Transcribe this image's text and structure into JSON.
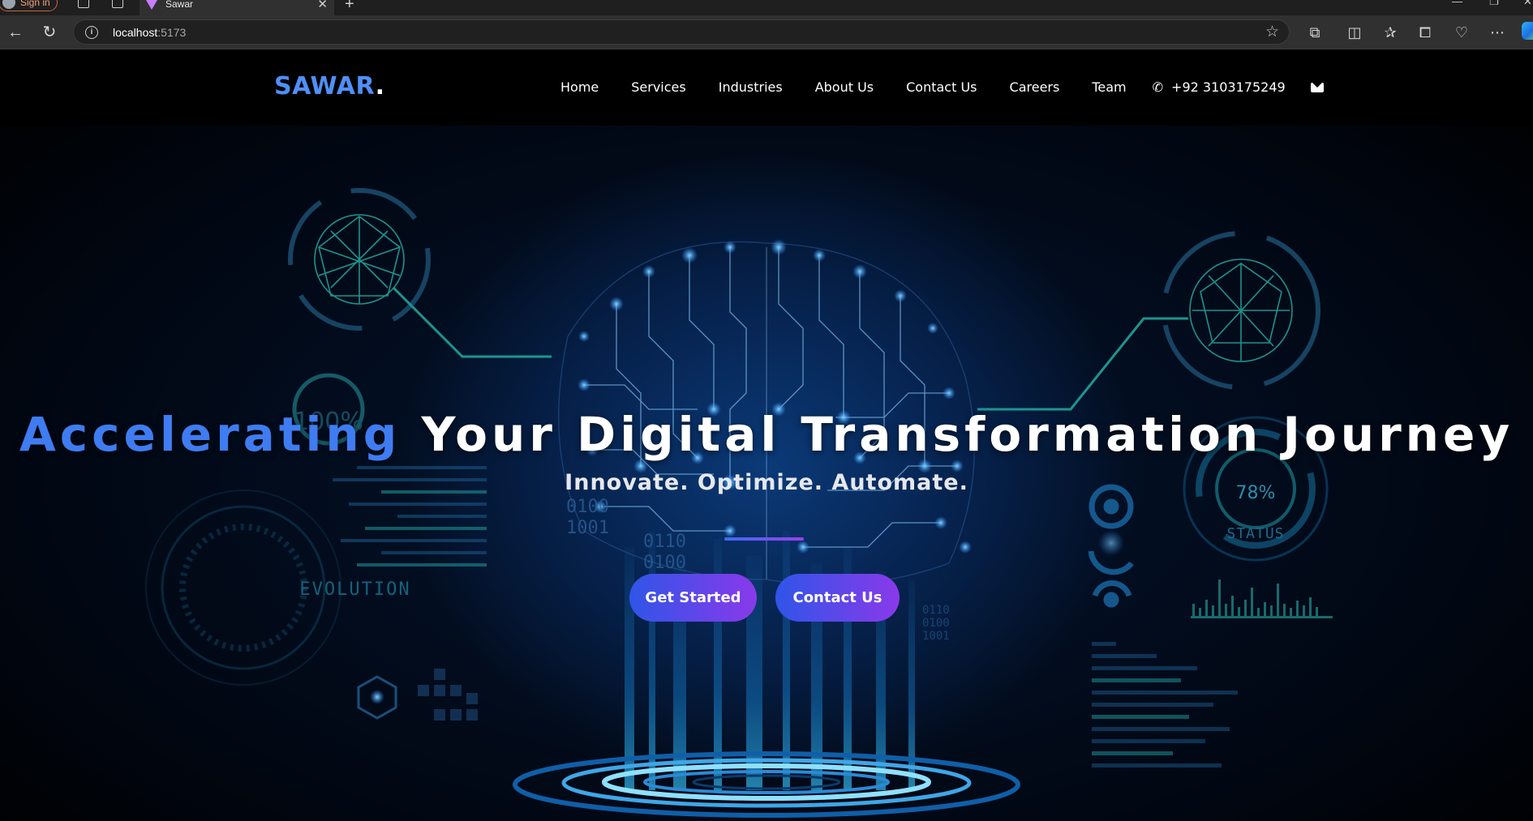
{
  "browser": {
    "signin_label": "Sign in",
    "tab_title": "Sawar",
    "url_host": "localhost",
    "url_port": ":5173"
  },
  "nav": {
    "brand": "SAWAR",
    "brand_dot": ".",
    "items": [
      "Home",
      "Services",
      "Industries",
      "About Us",
      "Contact Us",
      "Careers",
      "Team"
    ],
    "phone": "+92 3103175249"
  },
  "hero": {
    "headline_accent": "Accelerating",
    "headline_rest": "Your Digital Transformation Journey",
    "subheadline": "Innovate. Optimize. Automate.",
    "primary_button": "Get Started",
    "secondary_button": "Contact Us",
    "bg_texts": {
      "evolution": "EVOLUTION",
      "hundred": "100%",
      "percent": "78%",
      "status": "STATUS",
      "b1": "0100",
      "b2": "1001",
      "b3": "0110",
      "b4": "0100",
      "b5": "0110",
      "b6": "0100",
      "b7": "1001"
    }
  },
  "colors": {
    "accent_blue": "#3f7cf2",
    "button_gradient_start": "#2f55e8",
    "button_gradient_end": "#8a39ea",
    "nav_bg": "#000000"
  }
}
